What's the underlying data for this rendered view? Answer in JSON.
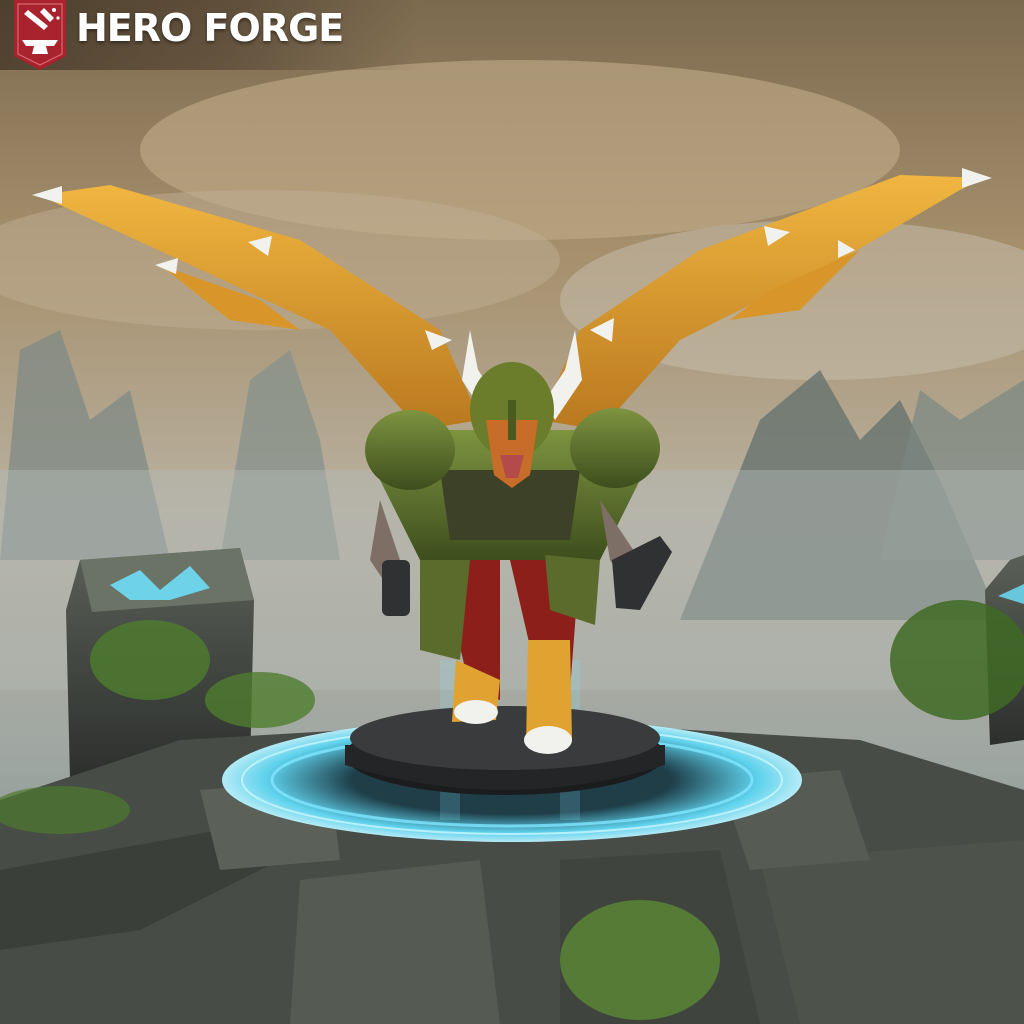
{
  "header": {
    "brand_name": "HERO FORGE",
    "logo_icon": "anvil-shield-icon",
    "logo_color": "#a9232e"
  },
  "scene": {
    "figure": "winged-horned-armored-miniature",
    "base_ring_color": "#6fe3ff",
    "wing_color": "#e0a331",
    "armor_color": "#5f7a2c"
  }
}
